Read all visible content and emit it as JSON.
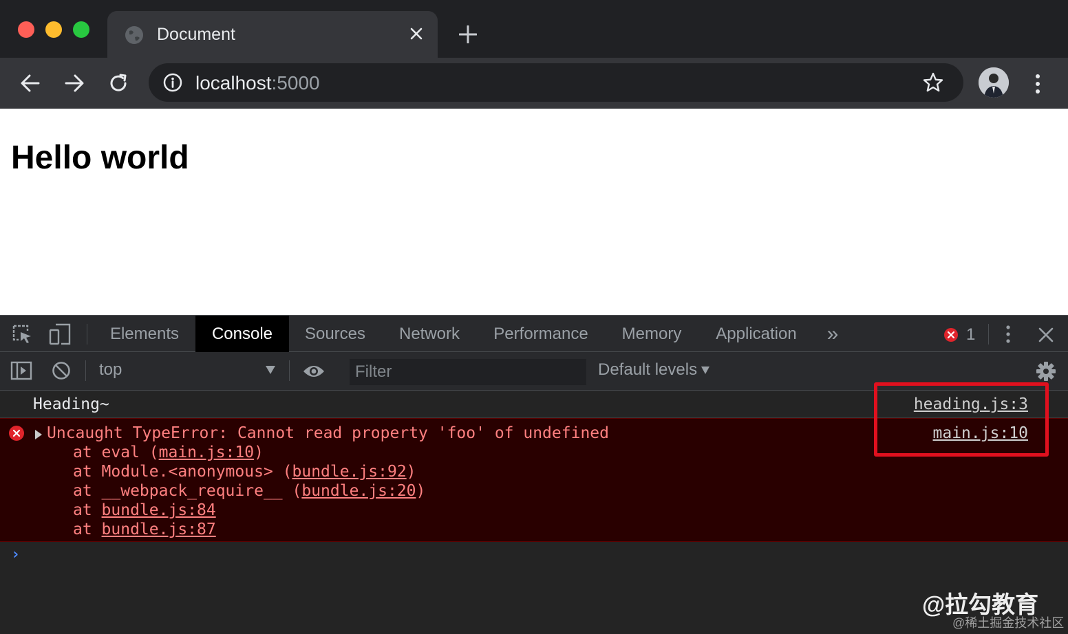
{
  "browser": {
    "tab_title": "Document",
    "url_host": "localhost",
    "url_port": ":5000"
  },
  "page": {
    "heading": "Hello world"
  },
  "devtools": {
    "tabs": [
      "Elements",
      "Console",
      "Sources",
      "Network",
      "Performance",
      "Memory",
      "Application"
    ],
    "active_tab": "Console",
    "more_tabs_label": "»",
    "error_count": "1",
    "context": "top",
    "filter_placeholder": "Filter",
    "levels_label": "Default levels"
  },
  "console": {
    "log_text": "Heading~",
    "log_source": "heading.js:3",
    "error_message": "Uncaught TypeError: Cannot read property 'foo' of undefined",
    "error_source": "main.js:10",
    "stack": [
      {
        "prefix": "at eval (",
        "link": "main.js:10",
        "suffix": ")"
      },
      {
        "prefix": "at Module.<anonymous> (",
        "link": "bundle.js:92",
        "suffix": ")"
      },
      {
        "prefix": "at __webpack_require__ (",
        "link": "bundle.js:20",
        "suffix": ")"
      },
      {
        "prefix": "at ",
        "link": "bundle.js:84",
        "suffix": ""
      },
      {
        "prefix": "at ",
        "link": "bundle.js:87",
        "suffix": ""
      }
    ],
    "prompt_symbol": "›"
  },
  "watermark": {
    "main": "@拉勾教育",
    "sub": "@稀土掘金技术社区"
  },
  "colors": {
    "error_text": "#ff8080",
    "error_bg": "#290000",
    "highlight": "#e0101e"
  }
}
